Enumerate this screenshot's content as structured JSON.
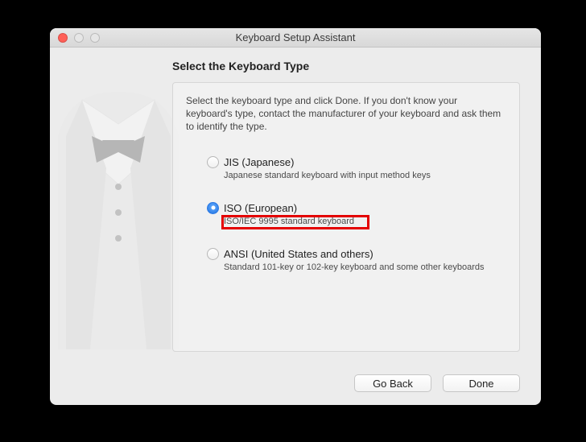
{
  "window": {
    "title": "Keyboard Setup Assistant"
  },
  "heading": "Select the Keyboard Type",
  "intro": "Select the keyboard type and click Done. If you don't know your keyboard's type, contact the manufacturer of your keyboard and ask them to identify the type.",
  "options": [
    {
      "label": "JIS (Japanese)",
      "desc": "Japanese standard keyboard with input method keys",
      "selected": false
    },
    {
      "label": "ISO (European)",
      "desc": "ISO/IEC 9995 standard keyboard",
      "selected": true
    },
    {
      "label": "ANSI (United States and others)",
      "desc": "Standard 101-key or 102-key keyboard and some other keyboards",
      "selected": false
    }
  ],
  "buttons": {
    "back": "Go Back",
    "done": "Done"
  }
}
